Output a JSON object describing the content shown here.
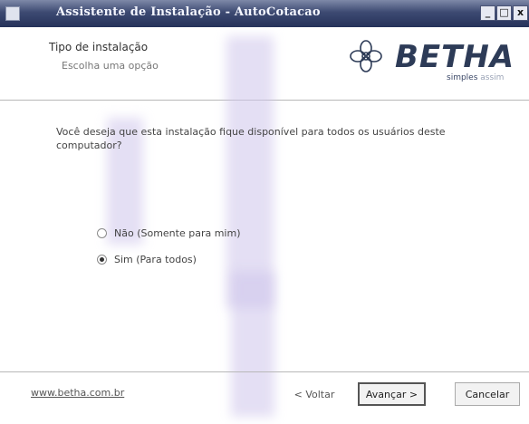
{
  "window": {
    "title": "Assistente de Instalação - AutoCotacao",
    "controls": {
      "minimize": "_",
      "maximize": "□",
      "close": "x"
    }
  },
  "header": {
    "title": "Tipo de instalação",
    "subtitle": "Escolha uma opção",
    "logo": {
      "brand": "BETHA",
      "tagline_strong": "simples",
      "tagline_soft": "assim"
    }
  },
  "content": {
    "question": "Você deseja que esta instalação fique disponível para todos os usuários deste computador?",
    "options": [
      {
        "label": "Não (Somente para mim)",
        "selected": false
      },
      {
        "label": "Sim (Para todos)",
        "selected": true
      }
    ]
  },
  "footer": {
    "link": "www.betha.com.br",
    "back_label": "< Voltar",
    "next_label": "Avançar >",
    "cancel_label": "Cancelar"
  },
  "colors": {
    "titlebar": "#26325a",
    "brand": "#2d3b57"
  }
}
